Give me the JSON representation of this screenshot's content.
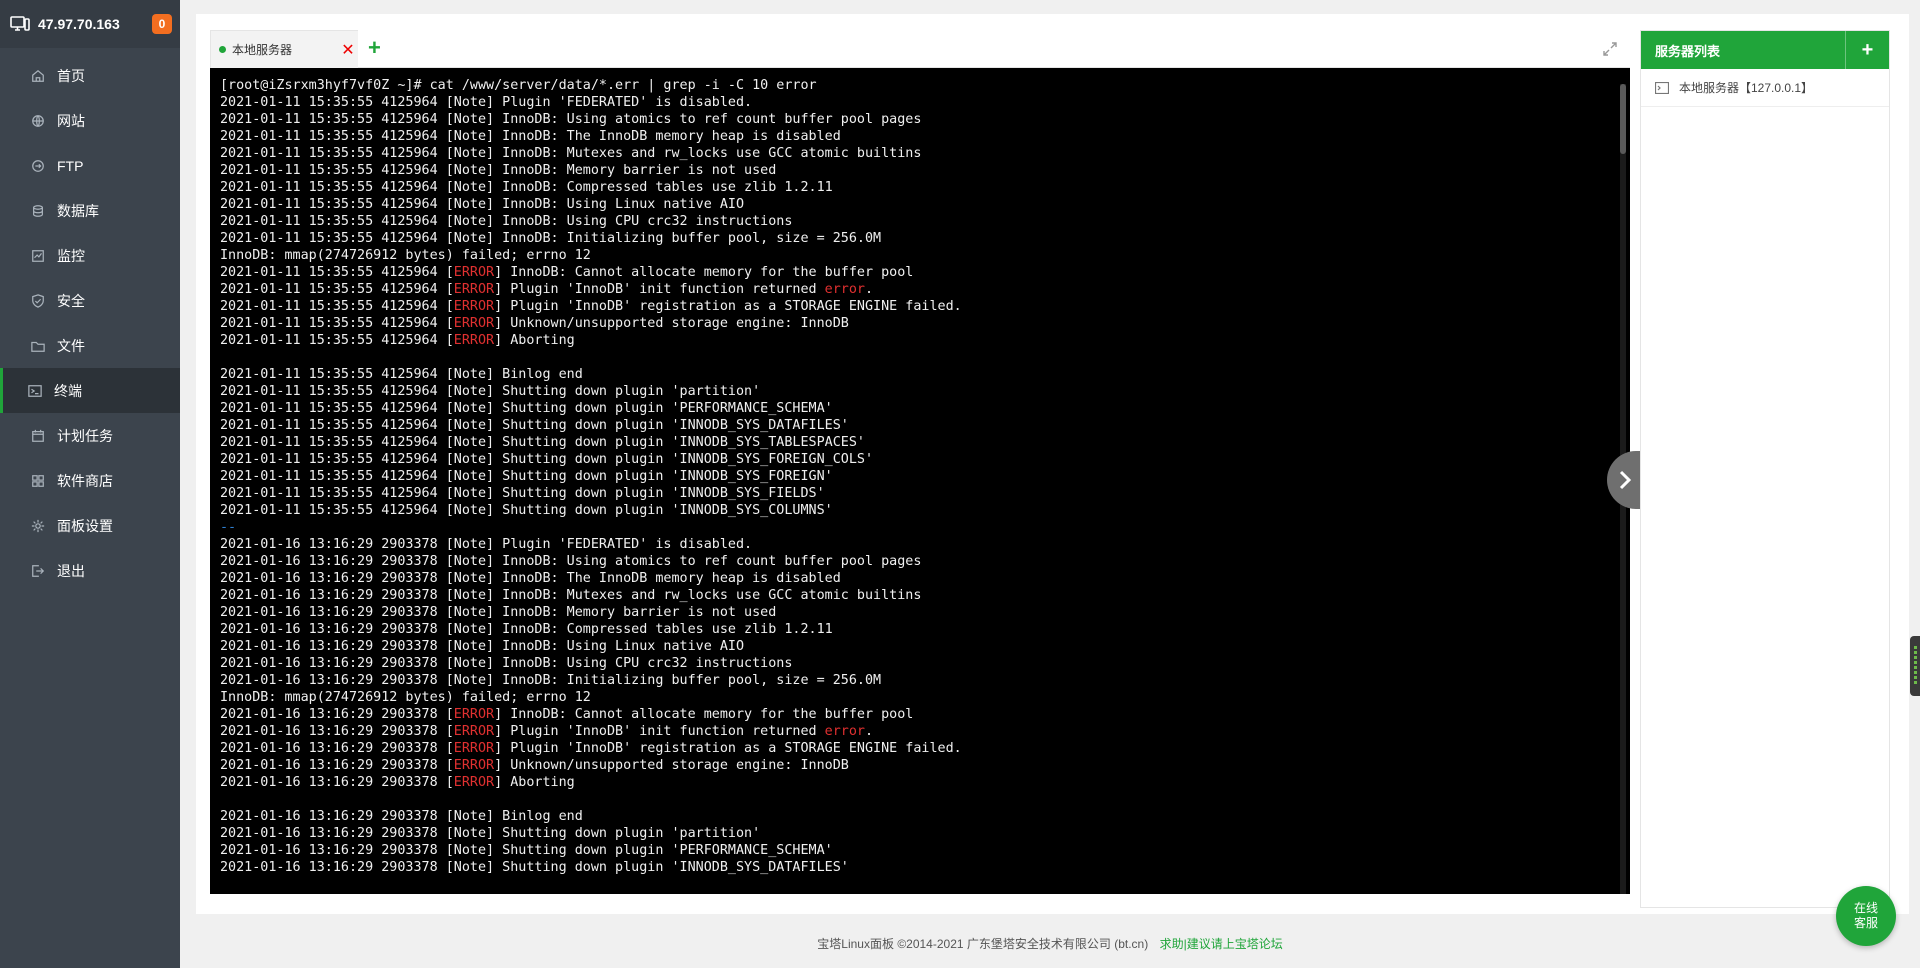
{
  "sidebar": {
    "ip": "47.97.70.163",
    "badge": "0",
    "items": [
      {
        "label": "首页",
        "icon": "home-icon"
      },
      {
        "label": "网站",
        "icon": "globe-icon"
      },
      {
        "label": "FTP",
        "icon": "ftp-icon"
      },
      {
        "label": "数据库",
        "icon": "database-icon"
      },
      {
        "label": "监控",
        "icon": "monitor-icon"
      },
      {
        "label": "安全",
        "icon": "shield-icon"
      },
      {
        "label": "文件",
        "icon": "folder-icon"
      },
      {
        "label": "终端",
        "icon": "terminal-icon",
        "active": true
      },
      {
        "label": "计划任务",
        "icon": "calendar-icon"
      },
      {
        "label": "软件商店",
        "icon": "apps-icon"
      },
      {
        "label": "面板设置",
        "icon": "gear-icon"
      },
      {
        "label": "退出",
        "icon": "logout-icon"
      }
    ]
  },
  "terminal": {
    "tab_label": "本地服务器",
    "close_glyph": "✕",
    "add_glyph": "+",
    "prompt": "[root@iZsrxm3hyf7vf0Z ~]# cat /www/server/data/*.err | grep -i -C 10 error",
    "blocks": [
      {
        "date": "2021-01-11 15:35:55 4125964",
        "notes_before": [
          "Plugin 'FEDERATED' is disabled.",
          "InnoDB: Using atomics to ref count buffer pool pages",
          "InnoDB: The InnoDB memory heap is disabled",
          "InnoDB: Mutexes and rw_locks use GCC atomic builtins",
          "InnoDB: Memory barrier is not used",
          "InnoDB: Compressed tables use zlib 1.2.11",
          "InnoDB: Using Linux native AIO",
          "InnoDB: Using CPU crc32 instructions",
          "InnoDB: Initializing buffer pool, size = 256.0M"
        ],
        "mmap_line": "InnoDB: mmap(274726912 bytes) failed; errno 12",
        "errors": [
          "InnoDB: Cannot allocate memory for the buffer pool",
          "Plugin 'InnoDB' init function returned |error|.",
          "Plugin 'InnoDB' registration as a STORAGE ENGINE failed.",
          "Unknown/unsupported storage engine: InnoDB",
          "Aborting"
        ],
        "notes_after": [
          "Binlog end",
          "Shutting down plugin 'partition'",
          "Shutting down plugin 'PERFORMANCE_SCHEMA'",
          "Shutting down plugin 'INNODB_SYS_DATAFILES'",
          "Shutting down plugin 'INNODB_SYS_TABLESPACES'",
          "Shutting down plugin 'INNODB_SYS_FOREIGN_COLS'",
          "Shutting down plugin 'INNODB_SYS_FOREIGN'",
          "Shutting down plugin 'INNODB_SYS_FIELDS'",
          "Shutting down plugin 'INNODB_SYS_COLUMNS'"
        ],
        "separator": "--"
      },
      {
        "date": "2021-01-16 13:16:29 2903378",
        "notes_before": [
          "Plugin 'FEDERATED' is disabled.",
          "InnoDB: Using atomics to ref count buffer pool pages",
          "InnoDB: The InnoDB memory heap is disabled",
          "InnoDB: Mutexes and rw_locks use GCC atomic builtins",
          "InnoDB: Memory barrier is not used",
          "InnoDB: Compressed tables use zlib 1.2.11",
          "InnoDB: Using Linux native AIO",
          "InnoDB: Using CPU crc32 instructions",
          "InnoDB: Initializing buffer pool, size = 256.0M"
        ],
        "mmap_line": "InnoDB: mmap(274726912 bytes) failed; errno 12",
        "errors": [
          "InnoDB: Cannot allocate memory for the buffer pool",
          "Plugin 'InnoDB' init function returned |error|.",
          "Plugin 'InnoDB' registration as a STORAGE ENGINE failed.",
          "Unknown/unsupported storage engine: InnoDB",
          "Aborting"
        ],
        "notes_after": [
          "Binlog end",
          "Shutting down plugin 'partition'",
          "Shutting down plugin 'PERFORMANCE_SCHEMA'",
          "Shutting down plugin 'INNODB_SYS_DATAFILES'"
        ],
        "separator": ""
      }
    ],
    "note_tag": "Note",
    "error_tag": "ERROR",
    "error_word": "error"
  },
  "server_list": {
    "title": "服务器列表",
    "add_glyph": "+",
    "items": [
      {
        "label": "本地服务器【127.0.0.1】"
      }
    ]
  },
  "footer": {
    "copyright": "宝塔Linux面板 ©2014-2021 广东堡塔安全技术有限公司 (bt.cn)",
    "link": "求助|建议请上宝塔论坛"
  },
  "support": {
    "line1": "在线",
    "line2": "客服"
  },
  "colors": {
    "accent": "#20a53a",
    "sidebar_bg": "#3c444d",
    "badge": "#f36e20",
    "error": "#e03030",
    "terminal_bg": "#000000"
  }
}
